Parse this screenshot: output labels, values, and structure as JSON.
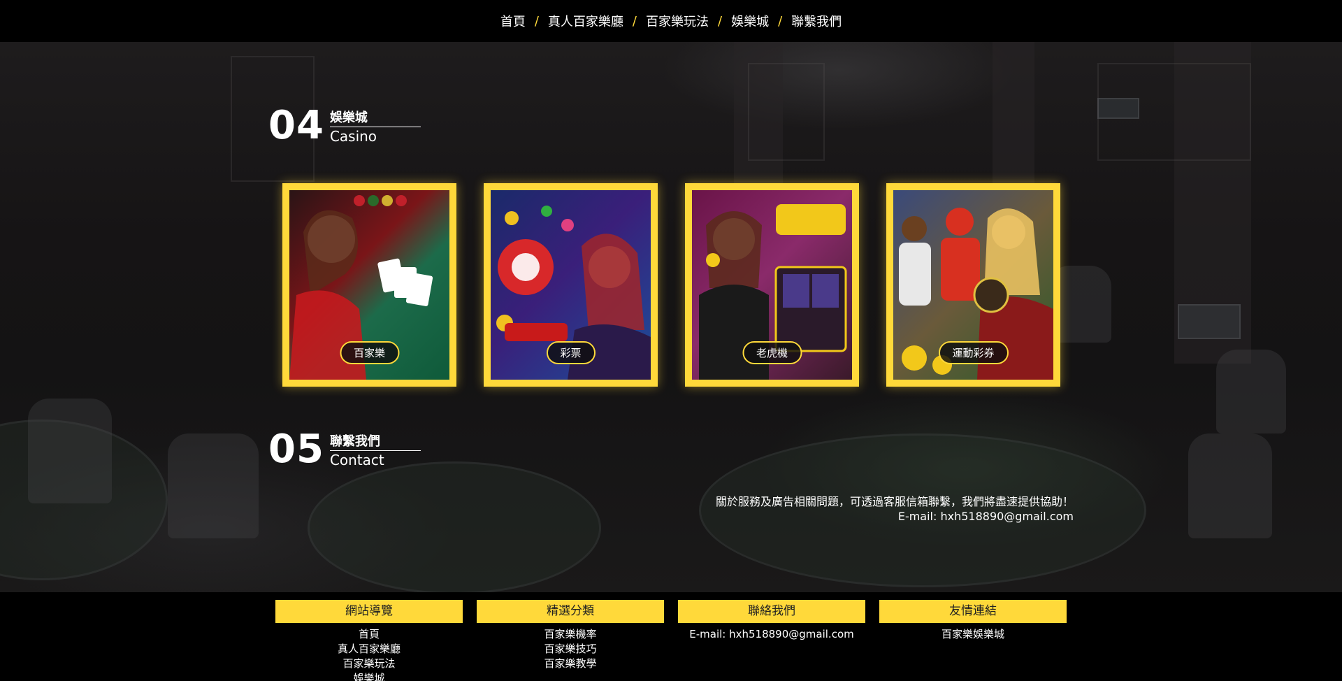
{
  "nav": {
    "items": [
      "首頁",
      "真人百家樂廳",
      "百家樂玩法",
      "娛樂城",
      "聯繫我們"
    ],
    "separator": "/"
  },
  "casino": {
    "number": "04",
    "title_zh": "娛樂城",
    "title_en": "Casino",
    "cards": [
      {
        "label": "百家樂",
        "art": "baccarat-dealer-art"
      },
      {
        "label": "彩票",
        "art": "lottery-balls-art"
      },
      {
        "label": "老虎機",
        "art": "fruit-slot-art"
      },
      {
        "label": "運動彩券",
        "art": "sports-betting-art"
      }
    ]
  },
  "contact": {
    "number": "05",
    "title_zh": "聯繫我們",
    "title_en": "Contact",
    "message": "關於服務及廣告相關問題，可透過客服信箱聯繫，我們將盡速提供協助！",
    "email": "E-mail: hxh518890@gmail.com"
  },
  "footer": {
    "columns": [
      {
        "heading": "網站導覽",
        "links": [
          "首頁",
          "真人百家樂廳",
          "百家樂玩法",
          "娛樂城"
        ]
      },
      {
        "heading": "精選分類",
        "links": [
          "百家樂機率",
          "百家樂技巧",
          "百家樂教學"
        ]
      },
      {
        "heading": "聯絡我們",
        "links": [
          "E-mail: hxh518890@gmail.com"
        ]
      },
      {
        "heading": "友情連結",
        "links": [
          "百家樂娛樂城"
        ]
      }
    ]
  },
  "colors": {
    "accent": "#ffd93a",
    "background": "#000000"
  }
}
